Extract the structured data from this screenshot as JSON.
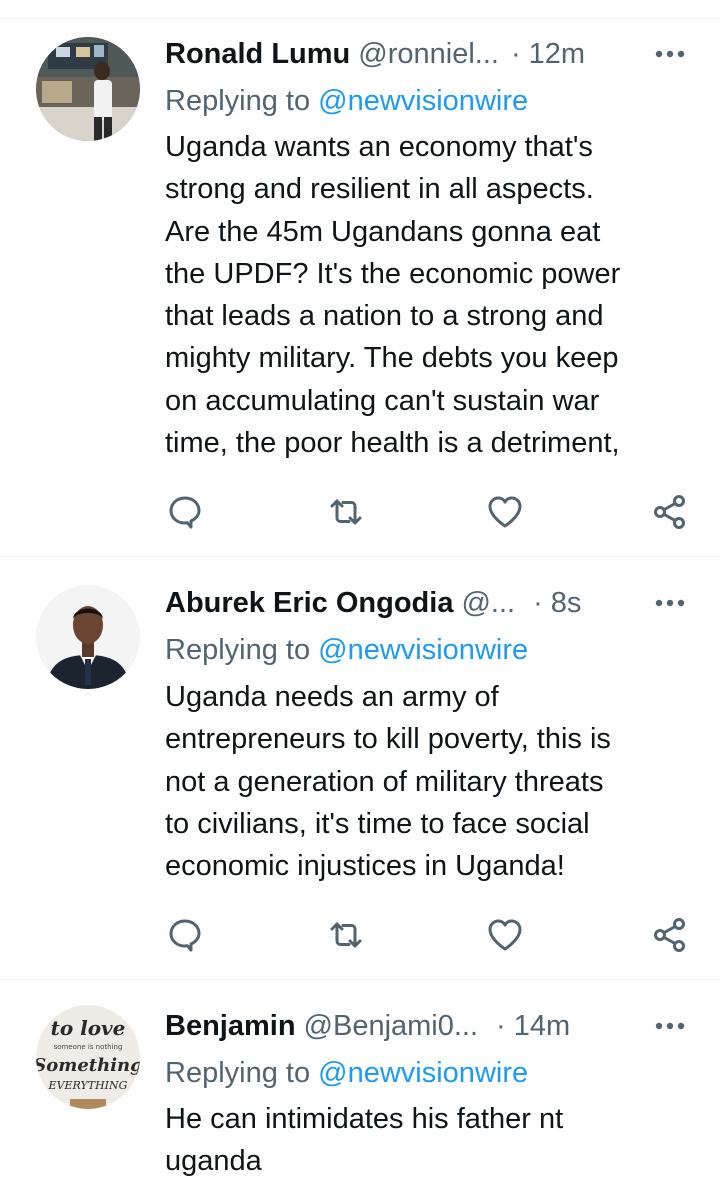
{
  "tweets": [
    {
      "name": "Ronald Lumu",
      "handle": "@ronniel...",
      "time": "· 12m",
      "replying_prefix": "Replying to ",
      "replying_to": "@newvisionwire",
      "text": "Uganda wants an economy that's\nstrong and resilient in all aspects.\nAre the 45m Ugandans gonna eat\nthe UPDF? It's the economic power\nthat leads a nation to a strong and\nmighty military. The debts you keep\non accumulating can't sustain war\ntime, the poor health is a detriment,"
    },
    {
      "name": "Aburek Eric Ongodia",
      "handle": "@...",
      "time": "· 8s",
      "replying_prefix": "Replying to ",
      "replying_to": "@newvisionwire",
      "text": "Uganda needs an army of\nentrepreneurs to kill poverty, this is\nnot a generation of military threats\nto civilians, it's time to face social\neconomic injustices in Uganda!"
    },
    {
      "name": "Benjamin",
      "handle": "@Benjami0...",
      "time": "· 14m",
      "replying_prefix": "Replying to ",
      "replying_to": "@newvisionwire",
      "text": "He can intimidates his father nt\nuganda",
      "avatar_words": [
        "to love",
        "someone is nothing",
        "Something",
        "EVERYTHING"
      ]
    }
  ],
  "icons": {
    "reply": "reply-icon",
    "retweet": "retweet-icon",
    "like": "heart-icon",
    "share": "share-icon",
    "more": "more-icon"
  },
  "colors": {
    "text": "#0f1419",
    "secondary": "#536471",
    "link": "#1d9bf0",
    "divider": "#eff3f4"
  }
}
